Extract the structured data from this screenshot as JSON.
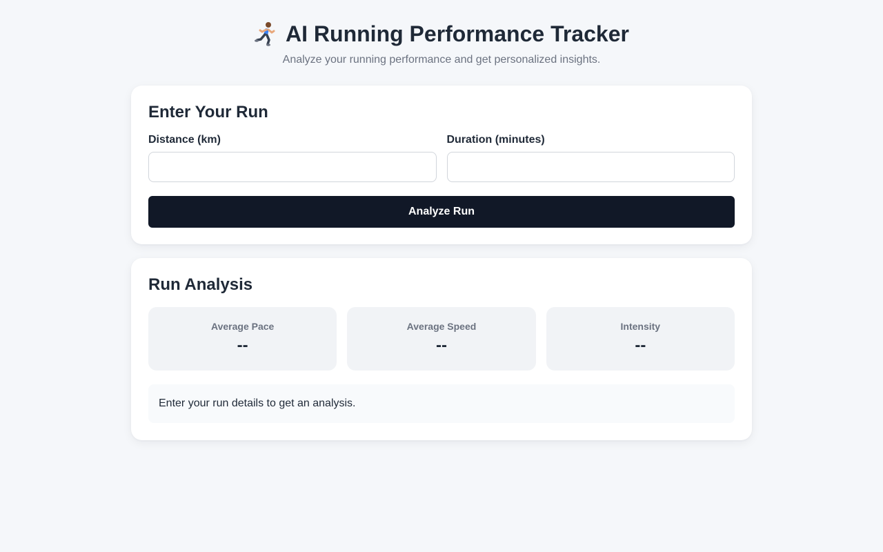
{
  "header": {
    "title": "AI Running Performance Tracker",
    "subtitle": "Analyze your running performance and get personalized insights.",
    "icon": "runner-icon"
  },
  "input_card": {
    "title": "Enter Your Run",
    "distance": {
      "label": "Distance (km)",
      "value": "",
      "placeholder": ""
    },
    "duration": {
      "label": "Duration (minutes)",
      "value": "",
      "placeholder": ""
    },
    "button_label": "Analyze Run"
  },
  "analysis_card": {
    "title": "Run Analysis",
    "stats": [
      {
        "label": "Average Pace",
        "value": "--"
      },
      {
        "label": "Average Speed",
        "value": "--"
      },
      {
        "label": "Intensity",
        "value": "--"
      }
    ],
    "message": "Enter your run details to get an analysis."
  },
  "colors": {
    "background": "#f5f7fa",
    "button": "#111827",
    "text": "#1f2937",
    "muted": "#6b7280"
  }
}
